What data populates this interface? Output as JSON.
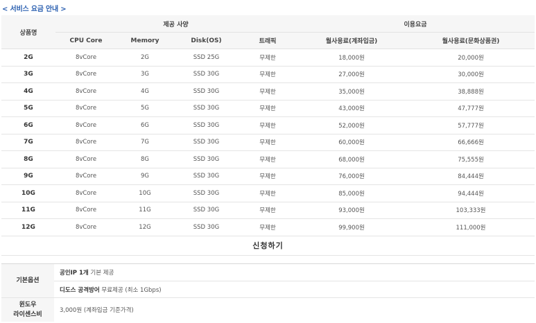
{
  "nav": {
    "back_link": "< 서비스 요금 안내 >"
  },
  "table": {
    "product_header": "상품명",
    "spec_group": "제공 사양",
    "price_group": "이용요금",
    "columns": [
      "CPU Core",
      "Memory",
      "Disk(OS)",
      "트래픽",
      "월사용료(계좌입금)",
      "월사용료(문화상품권)"
    ],
    "rows": [
      [
        "2G",
        "8vCore",
        "2G",
        "SSD 25G",
        "무제한",
        "18,000원",
        "20,000원"
      ],
      [
        "3G",
        "8vCore",
        "3G",
        "SSD 30G",
        "무제한",
        "27,000원",
        "30,000원"
      ],
      [
        "4G",
        "8vCore",
        "4G",
        "SSD 30G",
        "무제한",
        "35,000원",
        "38,888원"
      ],
      [
        "5G",
        "8vCore",
        "5G",
        "SSD 30G",
        "무제한",
        "43,000원",
        "47,777원"
      ],
      [
        "6G",
        "8vCore",
        "6G",
        "SSD 30G",
        "무제한",
        "52,000원",
        "57,777원"
      ],
      [
        "7G",
        "8vCore",
        "7G",
        "SSD 30G",
        "무제한",
        "60,000원",
        "66,666원"
      ],
      [
        "8G",
        "8vCore",
        "8G",
        "SSD 30G",
        "무제한",
        "68,000원",
        "75,555원"
      ],
      [
        "9G",
        "8vCore",
        "9G",
        "SSD 30G",
        "무제한",
        "76,000원",
        "84,444원"
      ],
      [
        "10G",
        "8vCore",
        "10G",
        "SSD 30G",
        "무제한",
        "85,000원",
        "94,444원"
      ],
      [
        "11G",
        "8vCore",
        "11G",
        "SSD 30G",
        "무제한",
        "93,000원",
        "103,333원"
      ],
      [
        "12G",
        "8vCore",
        "12G",
        "SSD 30G",
        "무제한",
        "99,900원",
        "111,000원"
      ]
    ],
    "apply_label": "신청하기"
  },
  "options": {
    "basic_label": "기본옵션",
    "basic_items": [
      {
        "bold": "공인IP 1개",
        "rest": " 기본 제공"
      },
      {
        "bold": "디도스 공격방어",
        "rest": " 무료제공 (최소 1Gbps)"
      }
    ],
    "license_label_1": "윈도우",
    "license_label_2": "라이센스비",
    "license_value": "3,000원 (계좌입금 기준가격)"
  }
}
